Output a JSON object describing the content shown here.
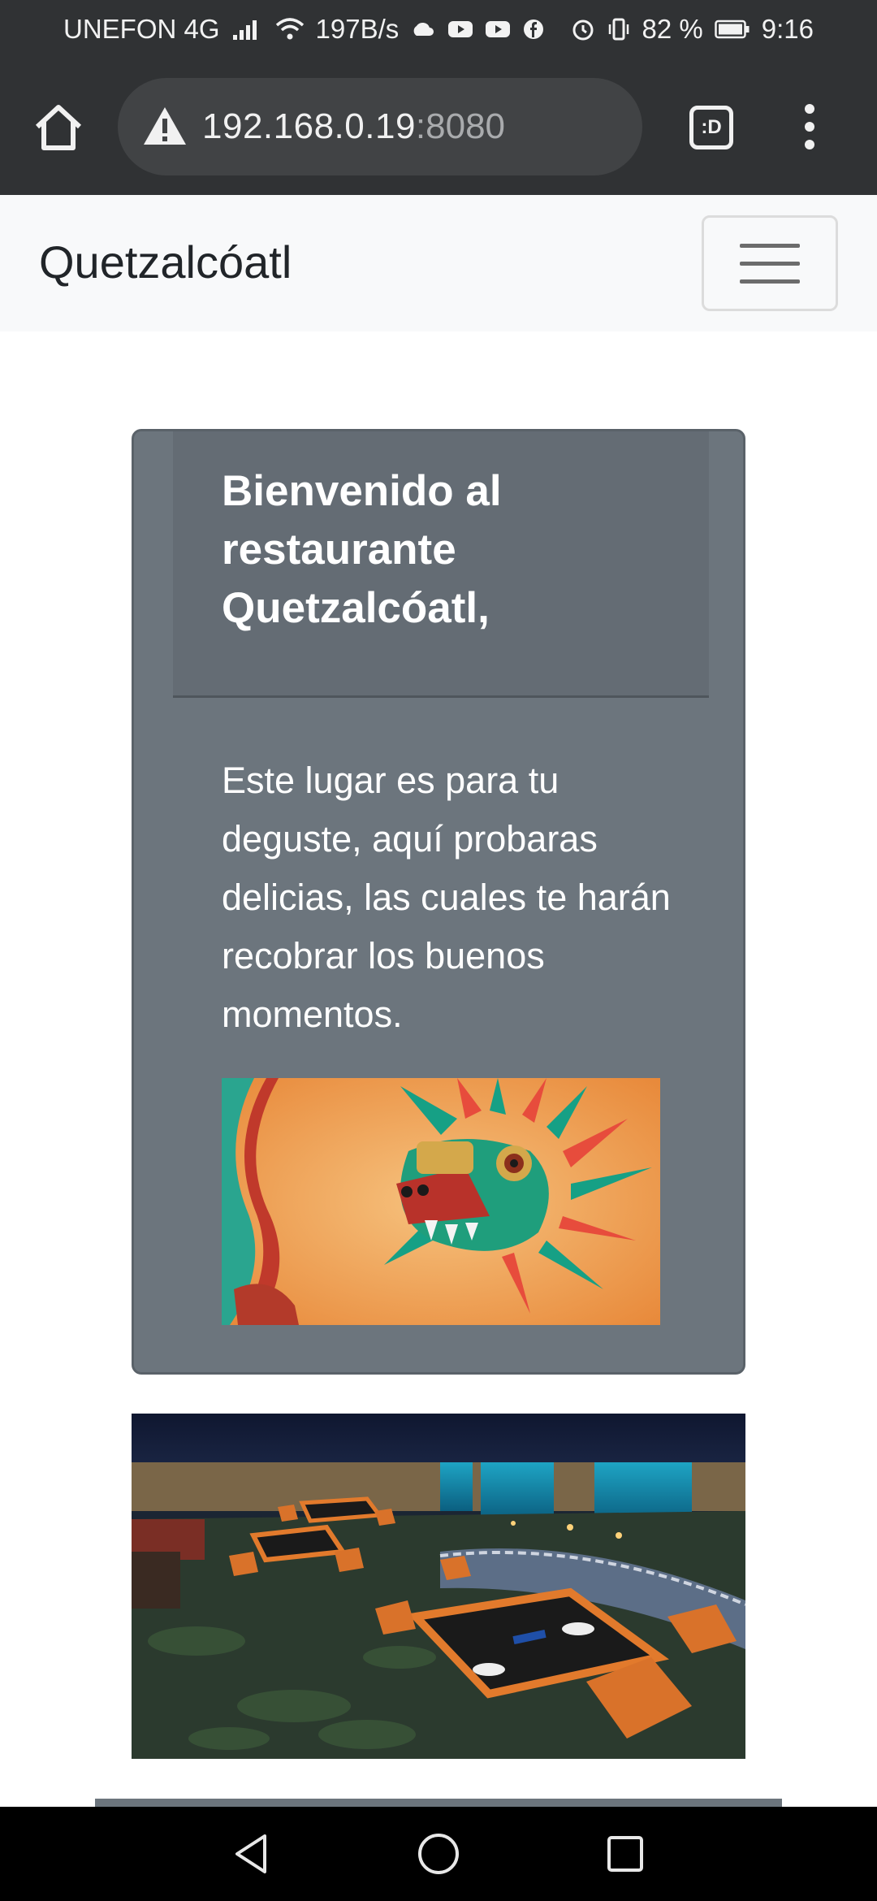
{
  "status_bar": {
    "carrier": "UNEFON 4G",
    "net_speed": "197B/s",
    "battery_percent": "82 %",
    "time": "9:16",
    "icons": [
      "signal-icon",
      "wifi-icon",
      "cloud-icon",
      "youtube-icon",
      "youtube-icon",
      "facebook-icon",
      "alarm-icon",
      "vibrate-icon",
      "battery-icon"
    ]
  },
  "browser": {
    "url_host": "192.168.0.19",
    "url_port": ":8080",
    "tabs_label": ":D",
    "security_icon": "warning-icon"
  },
  "navbar": {
    "brand": "Quetzalcóatl"
  },
  "card": {
    "title": "Bienvenido al restaurante Quetzalcóatl,",
    "text": "Este lugar es para tu deguste, aquí probaras delicias, las cuales te harán recobrar los buenos momentos."
  },
  "images": {
    "dragon": "quetzalcoatl-illustration",
    "restaurant": "restaurant-interior-photo"
  },
  "colors": {
    "card_bg": "#6c757d",
    "navbar_bg": "#f8f9fa",
    "browser_bg": "#303234"
  }
}
